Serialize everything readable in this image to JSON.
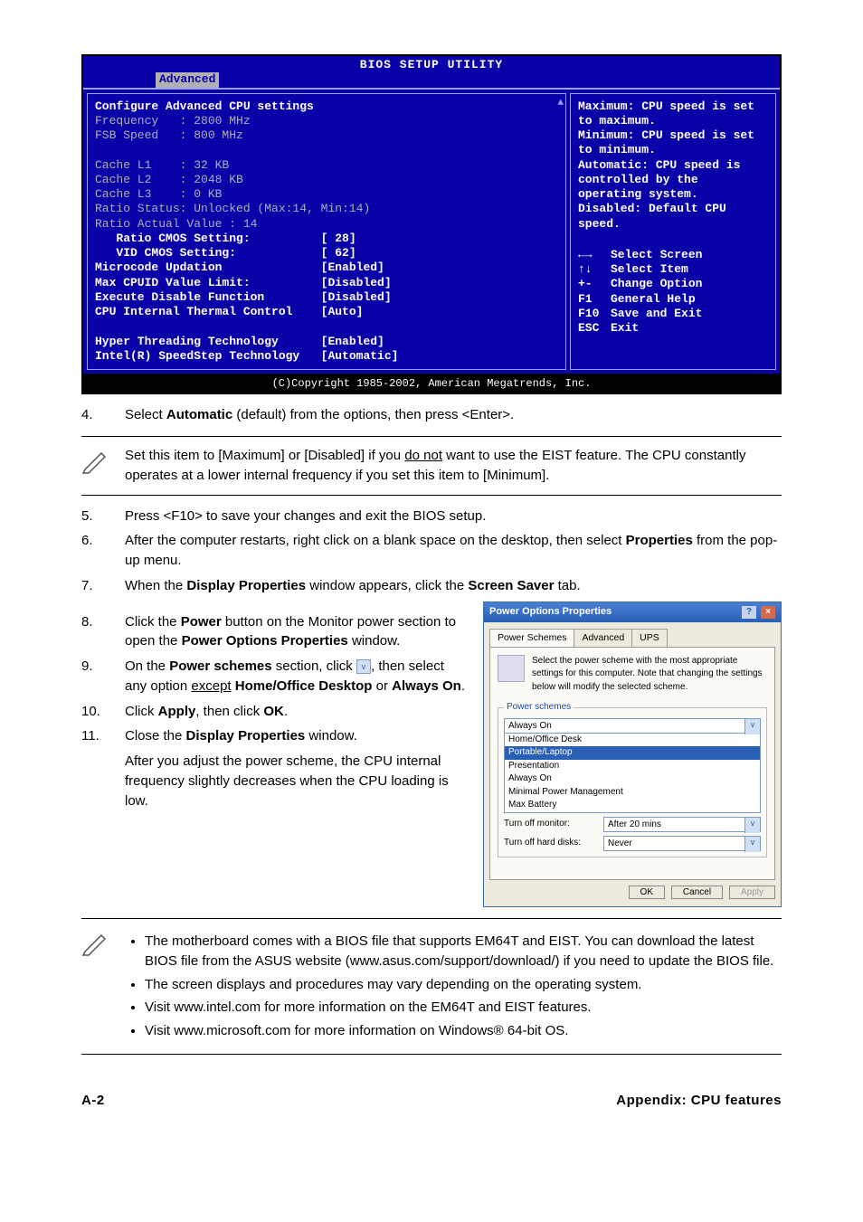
{
  "bios": {
    "title": "BIOS SETUP UTILITY",
    "tab": "Advanced",
    "heading": "Configure Advanced CPU settings",
    "info": [
      "Frequency   : 2800 MHz",
      "FSB Speed   : 800 MHz",
      "",
      "Cache L1    : 32 KB",
      "Cache L2    : 2048 KB",
      "Cache L3    : 0 KB",
      "Ratio Status: Unlocked (Max:14, Min:14)",
      "Ratio Actual Value : 14"
    ],
    "settings": [
      {
        "label": "   Ratio CMOS Setting:",
        "value": "[ 28]"
      },
      {
        "label": "   VID CMOS Setting:",
        "value": "[ 62]"
      },
      {
        "label": "Microcode Updation",
        "value": "[Enabled]"
      },
      {
        "label": "Max CPUID Value Limit:",
        "value": "[Disabled]"
      },
      {
        "label": "Execute Disable Function",
        "value": "[Disabled]"
      },
      {
        "label": "CPU Internal Thermal Control",
        "value": "[Auto]"
      },
      {
        "label": "",
        "value": ""
      },
      {
        "label": "Hyper Threading Technology",
        "value": "[Enabled]"
      },
      {
        "label": "Intel(R) SpeedStep Technology",
        "value": "[Automatic]"
      }
    ],
    "help_text": "Maximum: CPU speed is set to maximum.\nMinimum: CPU speed is set to minimum.\nAutomatic: CPU speed is controlled by the operating system.\nDisabled: Default CPU speed.",
    "keys": [
      {
        "k": "←→",
        "d": "Select Screen"
      },
      {
        "k": "↑↓",
        "d": "Select Item"
      },
      {
        "k": "+-",
        "d": "Change Option"
      },
      {
        "k": "F1",
        "d": "General Help"
      },
      {
        "k": "F10",
        "d": "Save and Exit"
      },
      {
        "k": "ESC",
        "d": "Exit"
      }
    ],
    "copyright": "(C)Copyright 1985-2002, American Megatrends, Inc."
  },
  "step4": {
    "num": "4.",
    "pre": "Select ",
    "bold": "Automatic",
    "post": " (default) from the options, then press <Enter>."
  },
  "note1": {
    "l1a": "Set this item to [Maximum] or [Disabled] if you ",
    "l1u": "do not",
    "l1b": " want to use the EIST feature. The CPU constantly operates at a lower internal frequency if you set this item to [Minimum]."
  },
  "step5": {
    "num": "5.",
    "text": "Press <F10> to save your changes and exit the BIOS setup."
  },
  "step6": {
    "num": "6.",
    "a": "After the computer restarts, right click on a blank space on the desktop, then select ",
    "b": "Properties",
    "c": " from the pop-up menu."
  },
  "step7": {
    "num": "7.",
    "a": "When the ",
    "b": "Display Properties",
    "c": " window appears, click the ",
    "d": "Screen Saver",
    "e": " tab."
  },
  "step8": {
    "num": "8.",
    "a": "Click the ",
    "b": "Power",
    "c": " button on the Monitor power section to open the ",
    "d": "Power Options Properties",
    "e": " window."
  },
  "step9": {
    "num": "9.",
    "a": "On the ",
    "b": "Power schemes",
    "c": " section, click ",
    "d": ", then select any option ",
    "du": "except",
    "e": " ",
    "f": "Home/Office Desktop",
    "g": " or ",
    "h": "Always On",
    "i": "."
  },
  "step10": {
    "num": "10.",
    "a": "Click ",
    "b": "Apply",
    "c": ", then click ",
    "d": "OK",
    "e": "."
  },
  "step11": {
    "num": "11.",
    "a": "Close the ",
    "b": "Display Properties",
    "c": " window.",
    "p2": "After you adjust the power scheme, the CPU internal frequency slightly decreases when the CPU loading is low."
  },
  "win": {
    "title": "Power Options Properties",
    "tabs": [
      "Power Schemes",
      "Advanced",
      "UPS"
    ],
    "desc": "Select the power scheme with the most appropriate settings for this computer. Note that changing the settings below will modify the selected scheme.",
    "legend": "Power schemes",
    "selected": "Always On",
    "options": [
      "Home/Office Desk",
      "Portable/Laptop",
      "Presentation",
      "Always On",
      "Minimal Power Management",
      "Max Battery"
    ],
    "highlight": 1,
    "row_monitor_label": "Turn off monitor:",
    "row_monitor_value": "After 20 mins",
    "row_disks_label": "Turn off hard disks:",
    "row_disks_value": "Never",
    "ok": "OK",
    "cancel": "Cancel",
    "apply": "Apply"
  },
  "note2": {
    "items": [
      "The motherboard comes with a BIOS file that supports EM64T and EIST. You can download the latest BIOS file from the ASUS website (www.asus.com/support/download/) if you need to update the BIOS file.",
      "The screen displays and procedures may vary depending on the operating system.",
      "Visit www.intel.com for more information on the EM64T and EIST features.",
      "Visit www.microsoft.com for more information on Windows® 64-bit OS."
    ]
  },
  "footer": {
    "left": "A-2",
    "right": "Appendix: CPU features"
  }
}
